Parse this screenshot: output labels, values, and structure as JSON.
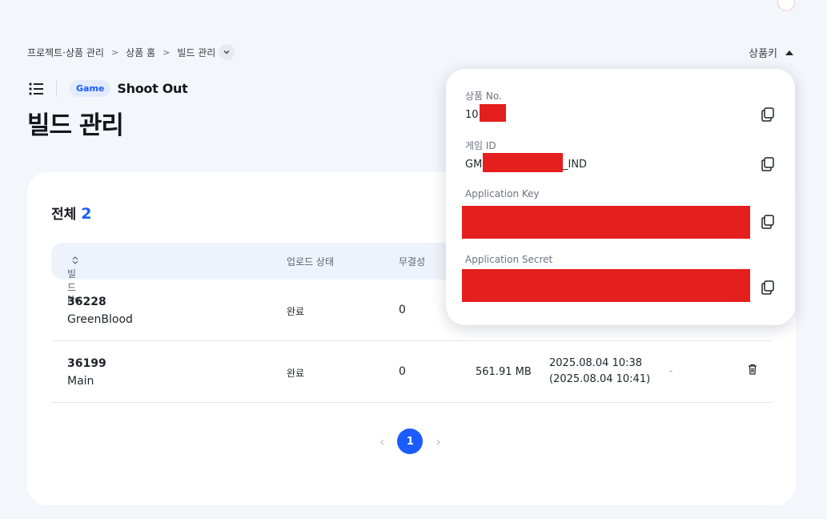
{
  "breadcrumb": {
    "items": [
      "프로젝트·상품 관리",
      "상품 홈",
      "빌드 관리"
    ],
    "separator": ">"
  },
  "product_key": {
    "label": "상품키"
  },
  "header": {
    "badge": "Game",
    "game_name": "Shoot Out",
    "page_title": "빌드 관리"
  },
  "list": {
    "total_label": "전체",
    "total_count": "2",
    "columns": {
      "build_no": "빌드 No.",
      "upload_status": "업로드 상태",
      "integrity": "무결성"
    },
    "rows": [
      {
        "no": "36228",
        "name": "GreenBlood",
        "status": "완료",
        "integrity": "0",
        "size": "",
        "date": "",
        "date2": "",
        "extra": ""
      },
      {
        "no": "36199",
        "name": "Main",
        "status": "완료",
        "integrity": "0",
        "size": "561.91 MB",
        "date": "2025.08.04 10:38",
        "date2": "(2025.08.04 10:41)",
        "extra": "-"
      }
    ]
  },
  "pagination": {
    "current": "1"
  },
  "popover": {
    "product_no_label": "상품 No.",
    "product_no_value": "10",
    "game_id_label": "게임 ID",
    "game_id_prefix": "GM",
    "game_id_suffix": "_IND",
    "app_key_label": "Application Key",
    "app_secret_label": "Application Secret"
  },
  "colors": {
    "accent": "#1a5cff",
    "redaction": "#e51e1e",
    "background": "#f3f6fb"
  }
}
